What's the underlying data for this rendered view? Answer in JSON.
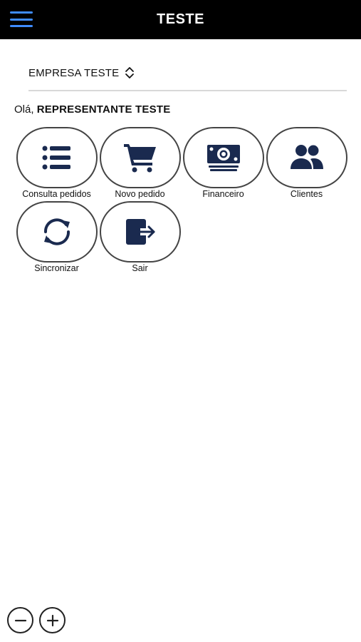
{
  "header": {
    "title": "TESTE",
    "menu_icon": "hamburger-menu-icon",
    "accent_color": "#3f8cff",
    "background_color": "#000000"
  },
  "company": {
    "name": "EMPRESA TESTE",
    "selector_icon": "chevron-up-down-icon"
  },
  "greeting": {
    "prefix": "Olá,",
    "user_name": "REPRESENTANTE TESTE"
  },
  "tiles": [
    {
      "label": "Consulta pedidos",
      "icon": "list-icon"
    },
    {
      "label": "Novo pedido",
      "icon": "shopping-cart-icon"
    },
    {
      "label": "Financeiro",
      "icon": "money-bill-icon"
    },
    {
      "label": "Clientes",
      "icon": "users-icon"
    },
    {
      "label": "Sincronizar",
      "icon": "sync-icon"
    },
    {
      "label": "Sair",
      "icon": "logout-icon"
    }
  ],
  "icon_color": "#1a2a4f",
  "zoom": {
    "out_icon": "zoom-out-icon",
    "in_icon": "zoom-in-icon"
  }
}
